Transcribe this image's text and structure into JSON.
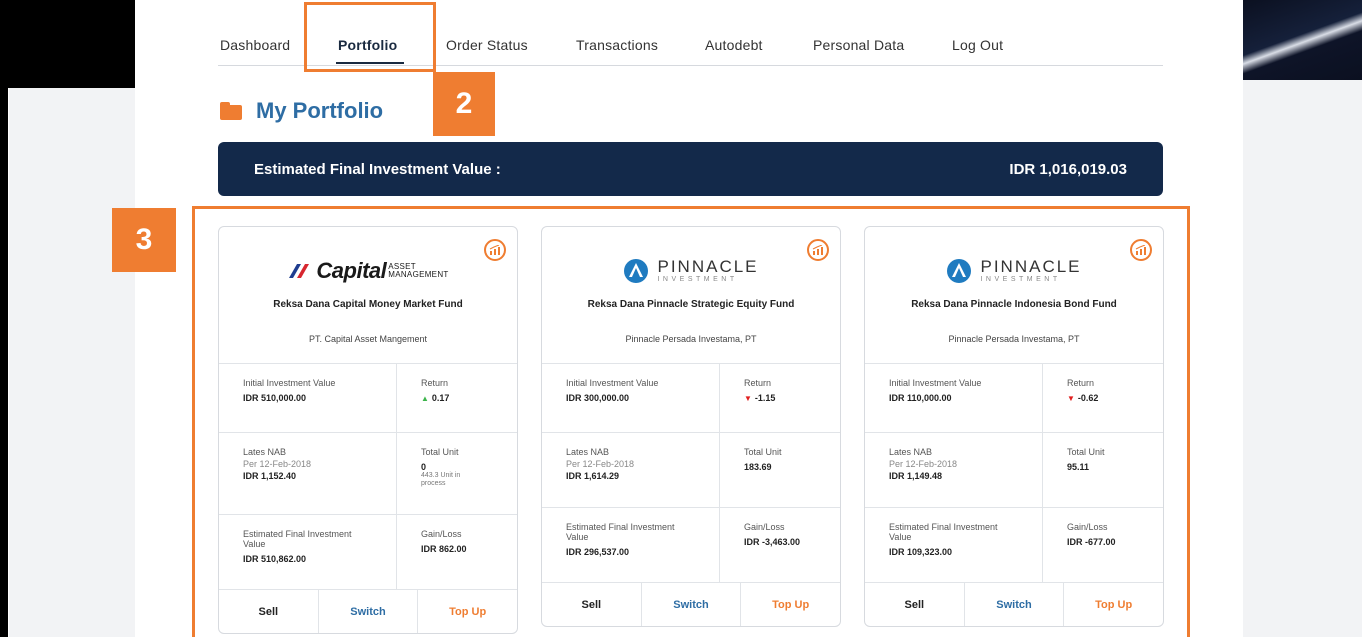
{
  "nav": {
    "items": [
      "Dashboard",
      "Portfolio",
      "Order Status",
      "Transactions",
      "Autodebt",
      "Personal Data",
      "Log Out"
    ],
    "active": "Portfolio"
  },
  "callouts": {
    "badge_2": "2",
    "badge_3": "3"
  },
  "page": {
    "title": "My Portfolio"
  },
  "summary": {
    "label": "Estimated Final Investment Value :",
    "value": "IDR 1,016,019.03"
  },
  "labels": {
    "initial": "Initial Investment Value",
    "return": "Return",
    "nab": "Lates NAB",
    "total_unit": "Total Unit",
    "estimated": "Estimated Final Investment Value",
    "gainloss": "Gain/Loss",
    "sell": "Sell",
    "switch": "Switch",
    "topup": "Top Up"
  },
  "funds": [
    {
      "logo": {
        "word": "Capital",
        "sub_top": "ASSET",
        "sub_bottom": "MANAGEMENT"
      },
      "name": "Reksa Dana Capital Money Market Fund",
      "manager": "PT. Capital Asset Mangement",
      "initial": "IDR 510,000.00",
      "return": "0.17",
      "return_dir": "up",
      "nab_date": "Per 12-Feb-2018",
      "nab": "IDR 1,152.40",
      "total_unit": "0",
      "unit_note": "443.3 Unit in process",
      "estimated": "IDR 510,862.00",
      "gainloss": "IDR 862.00"
    },
    {
      "logo": {
        "word": "PINNACLE",
        "sub": "INVESTMENT"
      },
      "name": "Reksa Dana Pinnacle Strategic Equity Fund",
      "manager": "Pinnacle Persada Investama, PT",
      "initial": "IDR 300,000.00",
      "return": "-1.15",
      "return_dir": "down",
      "nab_date": "Per 12-Feb-2018",
      "nab": "IDR 1,614.29",
      "total_unit": "183.69",
      "estimated": "IDR 296,537.00",
      "gainloss": "IDR -3,463.00"
    },
    {
      "logo": {
        "word": "PINNACLE",
        "sub": "INVESTMENT"
      },
      "name": "Reksa Dana Pinnacle Indonesia Bond Fund",
      "manager": "Pinnacle Persada Investama, PT",
      "initial": "IDR 110,000.00",
      "return": "-0.62",
      "return_dir": "down",
      "nab_date": "Per 12-Feb-2018",
      "nab": "IDR 1,149.48",
      "total_unit": "95.11",
      "estimated": "IDR 109,323.00",
      "gainloss": "IDR -677.00"
    }
  ],
  "colors": {
    "accent": "#ef7d31",
    "banner": "#13294a",
    "title": "#2e6da4",
    "up": "#3cb44b",
    "down": "#e02020"
  },
  "icons": {
    "title": "folder-icon",
    "card_action": "chart-icon",
    "return_up": "triangle-up-icon",
    "return_down": "triangle-down-icon"
  }
}
